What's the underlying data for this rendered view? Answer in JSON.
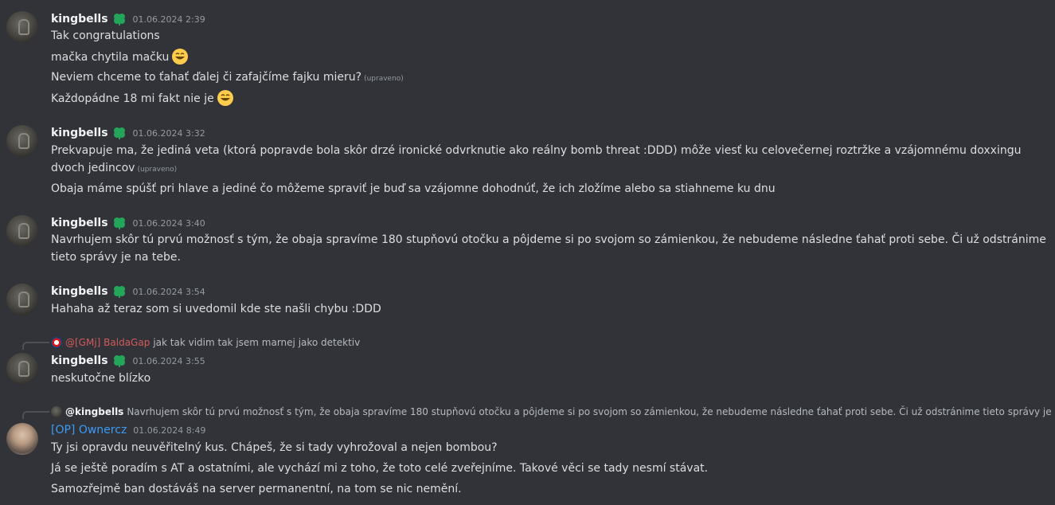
{
  "colors": {
    "background": "#313338",
    "text": "#dbdee1",
    "username": "#f2f3f5",
    "op_username": "#3b9bf5",
    "timestamp": "#949ba4",
    "mention_red": "#d15b5b",
    "clover_green": "#23a55a"
  },
  "messages": [
    {
      "author": "kingbells",
      "badge_icon": "clover-icon",
      "timestamp": "01.06.2024 2:39",
      "lines": [
        {
          "text": "Tak congratulations"
        },
        {
          "text": "mačka chytila mačku",
          "emoji": "grinning-face-icon"
        },
        {
          "text": "Neviem chceme to ťahať ďalej či zafajčíme fajku mieru?",
          "edited": "(upraveno)"
        },
        {
          "text": "Každopádne 18 mi fakt nie je",
          "emoji": "grinning-face-icon"
        }
      ]
    },
    {
      "author": "kingbells",
      "badge_icon": "clover-icon",
      "timestamp": "01.06.2024 3:32",
      "lines": [
        {
          "text": "Prekvapuje ma, že jediná veta (ktorá popravde bola skôr drzé ironické odvrknutie ako reálny bomb threat :DDD) môže viesť ku celovečernej roztržke a vzájomnému doxxingu dvoch jedincov",
          "edited": "(upraveno)"
        },
        {
          "text": "Obaja máme spúšť pri hlave a jediné čo môžeme spraviť je buď sa vzájomne dohodnúť, že ich zložíme alebo sa stiahneme ku dnu"
        }
      ]
    },
    {
      "author": "kingbells",
      "badge_icon": "clover-icon",
      "timestamp": "01.06.2024 3:40",
      "lines": [
        {
          "text": "Navrhujem skôr tú prvú možnosť s tým, že obaja spravíme 180 stupňovú otočku a pôjdeme si po svojom so zámienkou, že nebudeme následne ťahať proti sebe. Či už odstránime tieto správy je na tebe."
        }
      ]
    },
    {
      "author": "kingbells",
      "badge_icon": "clover-icon",
      "timestamp": "01.06.2024 3:54",
      "lines": [
        {
          "text": "Hahaha až teraz som si uvedomil kde ste našli chybu :DDD"
        }
      ]
    },
    {
      "reply": {
        "name": "@[GMj] BaldaGap",
        "text": "jak tak vidim tak jsem marnej jako detektiv"
      },
      "author": "kingbells",
      "badge_icon": "clover-icon",
      "timestamp": "01.06.2024 3:55",
      "lines": [
        {
          "text": "neskutočne blízko"
        }
      ]
    },
    {
      "reply": {
        "name": "@kingbells",
        "text": "Navrhujem skôr tú prvú možnosť s tým, že obaja spravíme 180 stupňovú otočku a pôjdeme si po svojom so zámienkou, že nebudeme následne ťahať proti sebe. Či už odstránime tieto správy je ..."
      },
      "author": "[OP] Ownercz",
      "timestamp": "01.06.2024 8:49",
      "lines": [
        {
          "text": "Ty jsi opravdu neuvěřitelný kus. Chápeš, že si tady vyhrožoval a nejen bombou?"
        },
        {
          "text": "Já se ještě poradím s AT a ostatními, ale vychází mi z toho, že toto celé zveřejníme. Takové věci se tady nesmí stávat."
        },
        {
          "text": "Samozřejmě ban dostáváš na server permanentní, na tom se nic nemění."
        }
      ]
    }
  ]
}
